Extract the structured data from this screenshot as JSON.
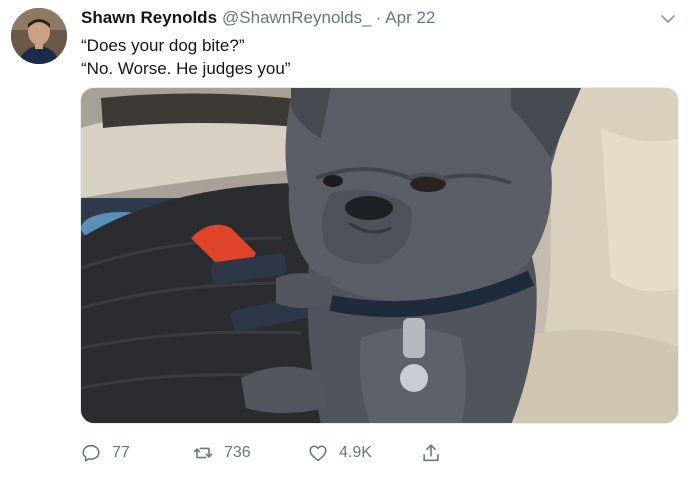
{
  "tweet": {
    "author_name": "Shawn Reynolds",
    "author_handle": "@ShawnReynolds_",
    "separator": "·",
    "date": "Apr 22",
    "text_lines": [
      "“Does your dog bite?”",
      "“No. Worse. He judges you”"
    ]
  },
  "actions": {
    "reply_count": "77",
    "retweet_count": "736",
    "like_count": "4.9K"
  },
  "icons": {
    "reply": "reply-icon",
    "retweet": "retweet-icon",
    "like": "heart-icon",
    "share": "share-icon",
    "menu": "chevron-down-icon"
  },
  "colors": {
    "text": "#14171a",
    "secondary": "#657786",
    "border": "#e6ecf0"
  }
}
